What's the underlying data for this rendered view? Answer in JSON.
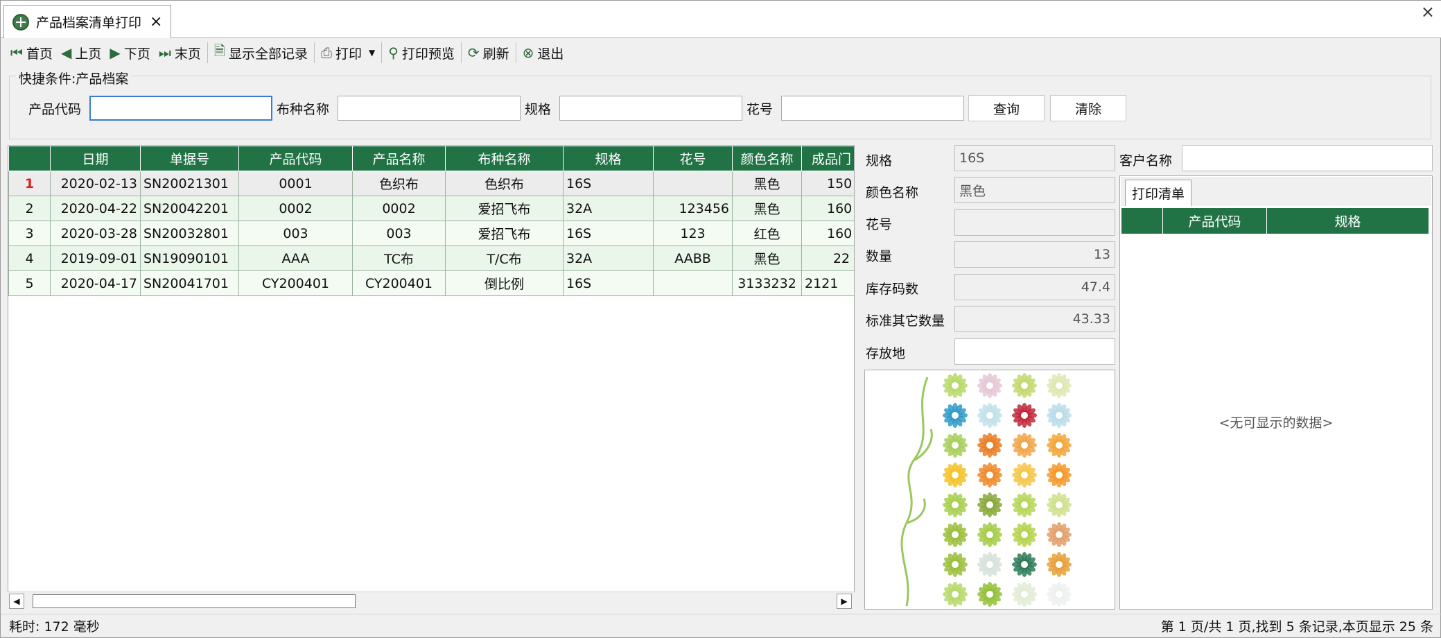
{
  "window": {
    "tab_title": "产品档案清单打印",
    "close_glyph": "×",
    "tab_close_glyph": "×"
  },
  "toolbar": {
    "first": "首页",
    "prev": "上页",
    "next": "下页",
    "last": "末页",
    "show_all": "显示全部记录",
    "print": "打印",
    "preview": "打印预览",
    "refresh": "刷新",
    "exit": "退出"
  },
  "quick_filter": {
    "legend": "快捷条件:产品档案",
    "product_code_label": "产品代码",
    "product_code_value": "",
    "fabric_name_label": "布种名称",
    "fabric_name_value": "",
    "spec_label": "规格",
    "spec_value": "",
    "pattern_label": "花号",
    "pattern_value": "",
    "query_button": "查询",
    "clear_button": "清除"
  },
  "grid": {
    "columns": [
      "日期",
      "单据号",
      "产品代码",
      "产品名称",
      "布种名称",
      "规格",
      "花号",
      "颜色名称",
      "成品门"
    ],
    "rows": [
      {
        "n": "1",
        "date": "2020-02-13",
        "doc": "SN20021301",
        "code": "0001",
        "name": "色织布",
        "fabric": "色织布",
        "spec": "16S",
        "pattern": "",
        "color": "黑色",
        "width": "150"
      },
      {
        "n": "2",
        "date": "2020-04-22",
        "doc": "SN20042201",
        "code": "0002",
        "name": "0002",
        "fabric": "爱招飞布",
        "spec": "32A",
        "pattern": "123456",
        "color": "黑色",
        "width": "160"
      },
      {
        "n": "3",
        "date": "2020-03-28",
        "doc": "SN20032801",
        "code": "003",
        "name": "003",
        "fabric": "爱招飞布",
        "spec": "16S",
        "pattern": "123",
        "color": "红色",
        "width": "160"
      },
      {
        "n": "4",
        "date": "2019-09-01",
        "doc": "SN19090101",
        "code": "AAA",
        "name": "TC布",
        "fabric": "T/C布",
        "spec": "32A",
        "pattern": "AABB",
        "color": "黑色",
        "width": "22"
      },
      {
        "n": "5",
        "date": "2020-04-17",
        "doc": "SN20041701",
        "code": "CY200401",
        "name": "CY200401",
        "fabric": "倒比例",
        "spec": "16S",
        "pattern": "",
        "color": "3133232",
        "width": "2121"
      }
    ]
  },
  "detail": {
    "spec_label": "规格",
    "spec_value": "16S",
    "color_label": "颜色名称",
    "color_value": "黑色",
    "pattern_label": "花号",
    "pattern_value": "",
    "qty_label": "数量",
    "qty_value": "13",
    "stock_label": "库存码数",
    "stock_value": "47.4",
    "std_label": "标准其它数量",
    "std_value": "43.33",
    "location_label": "存放地",
    "location_value": "",
    "customer_label": "客户名称",
    "customer_value": ""
  },
  "print_list": {
    "tab": "打印清单",
    "columns": [
      "产品代码",
      "规格"
    ],
    "empty_text": "<无可显示的数据>"
  },
  "status": {
    "time": "耗时: 172 毫秒",
    "paging": "第 1 页/共 1 页,找到 5 条记录,本页显示 25 条"
  },
  "colors": {
    "header_green": "#217346",
    "row_green": "#eaf6e9",
    "window_bg": "#f0f0f0"
  }
}
